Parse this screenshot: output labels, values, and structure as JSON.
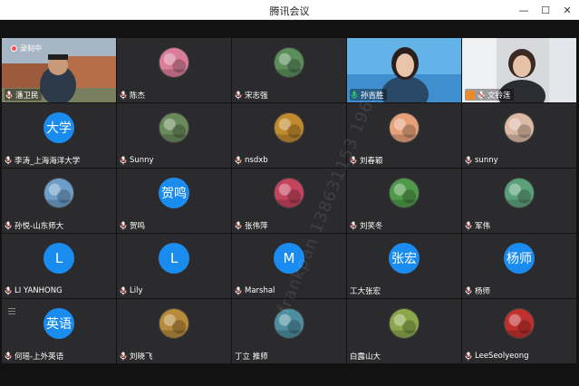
{
  "window": {
    "title": "腾讯会议",
    "minimize_glyph": "—",
    "maximize_glyph": "☐",
    "close_glyph": "✕"
  },
  "recording": {
    "label": "录制中"
  },
  "watermark": "frankpan 138631153 1963",
  "participants": [
    {
      "name": "潘卫民",
      "kind": "video",
      "scene": "campus"
    },
    {
      "name": "陈杰",
      "kind": "image",
      "avatar_desc": "portrait-woman-pink",
      "avatar_color": "#d97d9a"
    },
    {
      "name": "宋志强",
      "kind": "image",
      "avatar_desc": "landscape-flowers",
      "avatar_color": "#5b8e5a"
    },
    {
      "name": "孙吉胜",
      "kind": "video",
      "scene": "virtual-background-woman",
      "mic": "green"
    },
    {
      "name": "文铃莲",
      "kind": "video",
      "scene": "office-woman",
      "host": true
    },
    {
      "name": "李涛_上海海洋大学",
      "kind": "text",
      "avatar_text": "大学"
    },
    {
      "name": "Sunny",
      "kind": "image",
      "avatar_desc": "tree",
      "avatar_color": "#6a8a5b"
    },
    {
      "name": "nsdxb",
      "kind": "image",
      "avatar_desc": "autumn-leaves",
      "avatar_color": "#c08a2e"
    },
    {
      "name": "刘春颖",
      "kind": "image",
      "avatar_desc": "cartoon-girl",
      "avatar_color": "#e6a07a"
    },
    {
      "name": "sunny",
      "kind": "image",
      "avatar_desc": "girl-portrait",
      "avatar_color": "#dcb9a5"
    },
    {
      "name": "孙悦-山东师大",
      "kind": "image",
      "avatar_desc": "opera-house",
      "avatar_color": "#6d9ec9"
    },
    {
      "name": "贺鸣",
      "kind": "text",
      "avatar_text": "贺鸣"
    },
    {
      "name": "张伟萍",
      "kind": "image",
      "avatar_desc": "rose",
      "avatar_color": "#c4435d"
    },
    {
      "name": "刘笑冬",
      "kind": "image",
      "avatar_desc": "green-field",
      "avatar_color": "#4f9a4a"
    },
    {
      "name": "军伟",
      "kind": "image",
      "avatar_desc": "grassland-sky",
      "avatar_color": "#5aa17a"
    },
    {
      "name": "LI YANHONG",
      "kind": "text",
      "avatar_text": "L"
    },
    {
      "name": "Lily",
      "kind": "text",
      "avatar_text": "L"
    },
    {
      "name": "Marshal",
      "kind": "text",
      "avatar_text": "M"
    },
    {
      "name": "工大张宏",
      "kind": "text",
      "avatar_text": "张宏",
      "no_mic": true
    },
    {
      "name": "杨师",
      "kind": "text",
      "avatar_text": "杨师"
    },
    {
      "name": "何瑶-上外英语",
      "kind": "text",
      "avatar_text": "英语"
    },
    {
      "name": "刘晓飞",
      "kind": "image",
      "avatar_desc": "flower-bouquet",
      "avatar_color": "#b58a3a"
    },
    {
      "name": "丁立 推师",
      "kind": "image",
      "avatar_desc": "lake-mountain",
      "avatar_color": "#4e8ea0",
      "no_mic": true
    },
    {
      "name": "白露山大",
      "kind": "image",
      "avatar_desc": "autumn-trees",
      "avatar_color": "#8aa84a",
      "no_mic": true
    },
    {
      "name": "LeeSeolyeong",
      "kind": "image",
      "avatar_desc": "red-abstract",
      "avatar_color": "#c0302e"
    }
  ]
}
